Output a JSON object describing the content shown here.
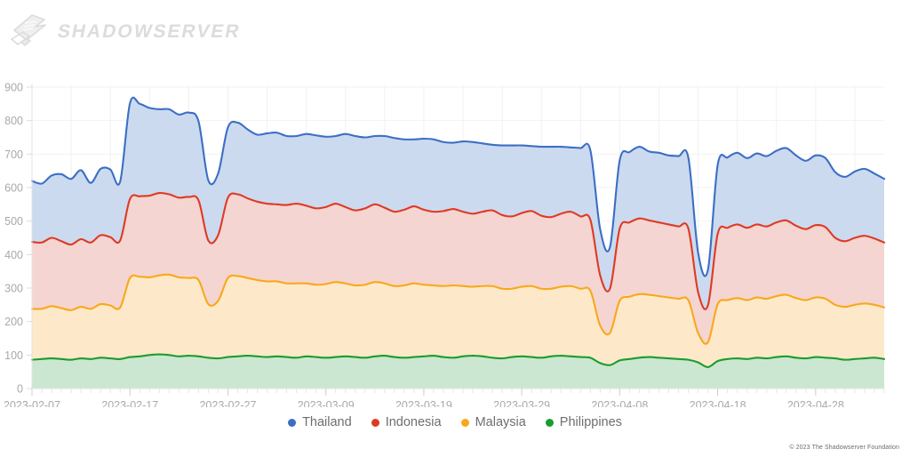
{
  "brand": {
    "name": "SHADOWSERVER",
    "logo_icon": "shadowserver-flag-icon"
  },
  "copyright": "© 2023 The Shadowserver Foundation",
  "legend": {
    "items": [
      {
        "label": "Thailand",
        "color": "#3b6fc4",
        "fill": "#ccdaef",
        "icon": "legend-dot-icon"
      },
      {
        "label": "Indonesia",
        "color": "#df3a23",
        "fill": "#f4d5d1",
        "icon": "legend-dot-icon"
      },
      {
        "label": "Malaysia",
        "color": "#f9a81b",
        "fill": "#fde9c9",
        "icon": "legend-dot-icon"
      },
      {
        "label": "Philippines",
        "color": "#1b9c2e",
        "fill": "#cce7d1",
        "icon": "legend-dot-icon"
      }
    ]
  },
  "chart_data": {
    "type": "area",
    "stacked": true,
    "title": "",
    "xlabel": "",
    "ylabel": "",
    "ylim": [
      0,
      900
    ],
    "yticks": [
      0,
      100,
      200,
      300,
      400,
      500,
      600,
      700,
      800,
      900
    ],
    "grid": true,
    "legend_position": "bottom",
    "x_start": "2023-02-07",
    "x_end": "2023-05-05",
    "xticks": [
      "2023-02-07",
      "2023-02-17",
      "2023-02-27",
      "2023-03-09",
      "2023-03-19",
      "2023-03-29",
      "2023-04-08",
      "2023-04-18",
      "2023-04-28"
    ],
    "xtick_interval_days": 10,
    "n_points": 88,
    "series": [
      {
        "name": "Philippines",
        "color": "#1b9c2e",
        "fill": "#cce7d1",
        "values": [
          86,
          88,
          90,
          88,
          86,
          90,
          88,
          92,
          90,
          88,
          94,
          96,
          100,
          102,
          100,
          96,
          98,
          96,
          92,
          90,
          94,
          96,
          98,
          96,
          94,
          96,
          94,
          92,
          96,
          94,
          92,
          94,
          96,
          94,
          92,
          96,
          98,
          94,
          92,
          94,
          96,
          98,
          94,
          92,
          96,
          98,
          96,
          92,
          90,
          94,
          96,
          94,
          92,
          96,
          98,
          96,
          94,
          92,
          76,
          70,
          84,
          88,
          92,
          94,
          92,
          90,
          88,
          86,
          78,
          64,
          82,
          88,
          90,
          88,
          92,
          90,
          94,
          96,
          92,
          90,
          94,
          92,
          90,
          86,
          88,
          90,
          92,
          88
        ]
      },
      {
        "name": "Malaysia",
        "color": "#f9a81b",
        "fill": "#fde9c9",
        "values": [
          152,
          150,
          156,
          152,
          148,
          154,
          150,
          160,
          158,
          154,
          236,
          238,
          232,
          236,
          240,
          236,
          232,
          228,
          160,
          172,
          236,
          240,
          232,
          228,
          226,
          224,
          220,
          222,
          218,
          216,
          220,
          224,
          218,
          214,
          218,
          222,
          216,
          212,
          216,
          220,
          214,
          210,
          212,
          216,
          210,
          206,
          210,
          214,
          208,
          204,
          208,
          212,
          206,
          202,
          206,
          210,
          204,
          200,
          112,
          96,
          178,
          186,
          190,
          186,
          184,
          182,
          180,
          178,
          88,
          74,
          170,
          176,
          180,
          176,
          180,
          178,
          182,
          184,
          178,
          174,
          178,
          176,
          160,
          158,
          162,
          164,
          158,
          154
        ]
      },
      {
        "name": "Indonesia",
        "color": "#df3a23",
        "fill": "#f4d5d1",
        "values": [
          200,
          198,
          204,
          200,
          196,
          202,
          198,
          206,
          204,
          200,
          236,
          240,
          244,
          246,
          240,
          238,
          242,
          238,
          190,
          196,
          240,
          244,
          238,
          234,
          232,
          230,
          234,
          238,
          232,
          228,
          230,
          234,
          228,
          224,
          228,
          232,
          226,
          222,
          226,
          230,
          224,
          220,
          224,
          228,
          222,
          218,
          222,
          226,
          220,
          216,
          220,
          224,
          218,
          214,
          218,
          222,
          216,
          212,
          150,
          132,
          216,
          222,
          226,
          222,
          220,
          218,
          216,
          214,
          122,
          110,
          210,
          216,
          220,
          216,
          218,
          216,
          220,
          222,
          216,
          212,
          216,
          214,
          200,
          196,
          200,
          202,
          198,
          194
        ]
      },
      {
        "name": "Thailand",
        "color": "#3b6fc4",
        "fill": "#ccdaef",
        "values": [
          182,
          176,
          186,
          200,
          196,
          206,
          178,
          198,
          202,
          176,
          286,
          276,
          262,
          250,
          254,
          248,
          252,
          236,
          180,
          184,
          210,
          214,
          206,
          200,
          210,
          214,
          206,
          202,
          214,
          218,
          210,
          202,
          218,
          222,
          212,
          204,
          214,
          220,
          210,
          200,
          212,
          216,
          206,
          198,
          210,
          214,
          204,
          196,
          208,
          212,
          202,
          194,
          206,
          210,
          200,
          192,
          204,
          208,
          138,
          124,
          204,
          210,
          214,
          206,
          208,
          206,
          210,
          212,
          118,
          106,
          206,
          210,
          214,
          208,
          212,
          210,
          214,
          216,
          210,
          204,
          208,
          206,
          196,
          192,
          198,
          200,
          194,
          190
        ]
      }
    ]
  }
}
